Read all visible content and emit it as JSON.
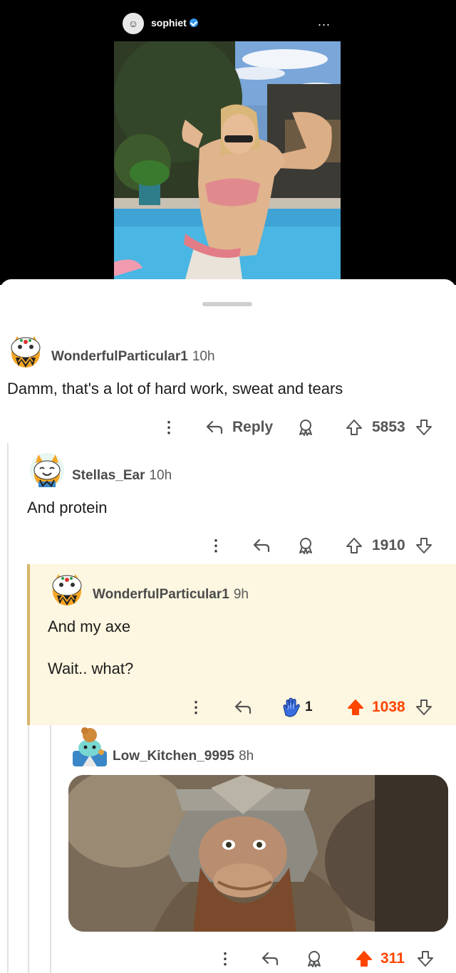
{
  "post": {
    "username": "sophiet",
    "more_label": "...",
    "avatar_icon": "person-avatar-icon"
  },
  "comments": [
    {
      "username": "WonderfulParticular1",
      "time": "10h",
      "text": "Damm, that's a lot of hard work, sweat and tears",
      "reply_label": "Reply",
      "votes": "5853"
    },
    {
      "username": "Stellas_Ear",
      "time": "10h",
      "text": "And protein",
      "votes": "1910"
    },
    {
      "username": "WonderfulParticular1",
      "time": "9h",
      "text_line1": "And my axe",
      "text_line2": "Wait.. what?",
      "award_count": "1",
      "votes": "1038"
    },
    {
      "username": "Low_Kitchen_9995",
      "time": "8h",
      "votes": "311"
    }
  ],
  "colors": {
    "upvote_active": "#ff4500",
    "highlight_bg": "#fdf6e0",
    "highlight_bar": "#d7b46a",
    "award_blue": "#3b6de0"
  }
}
